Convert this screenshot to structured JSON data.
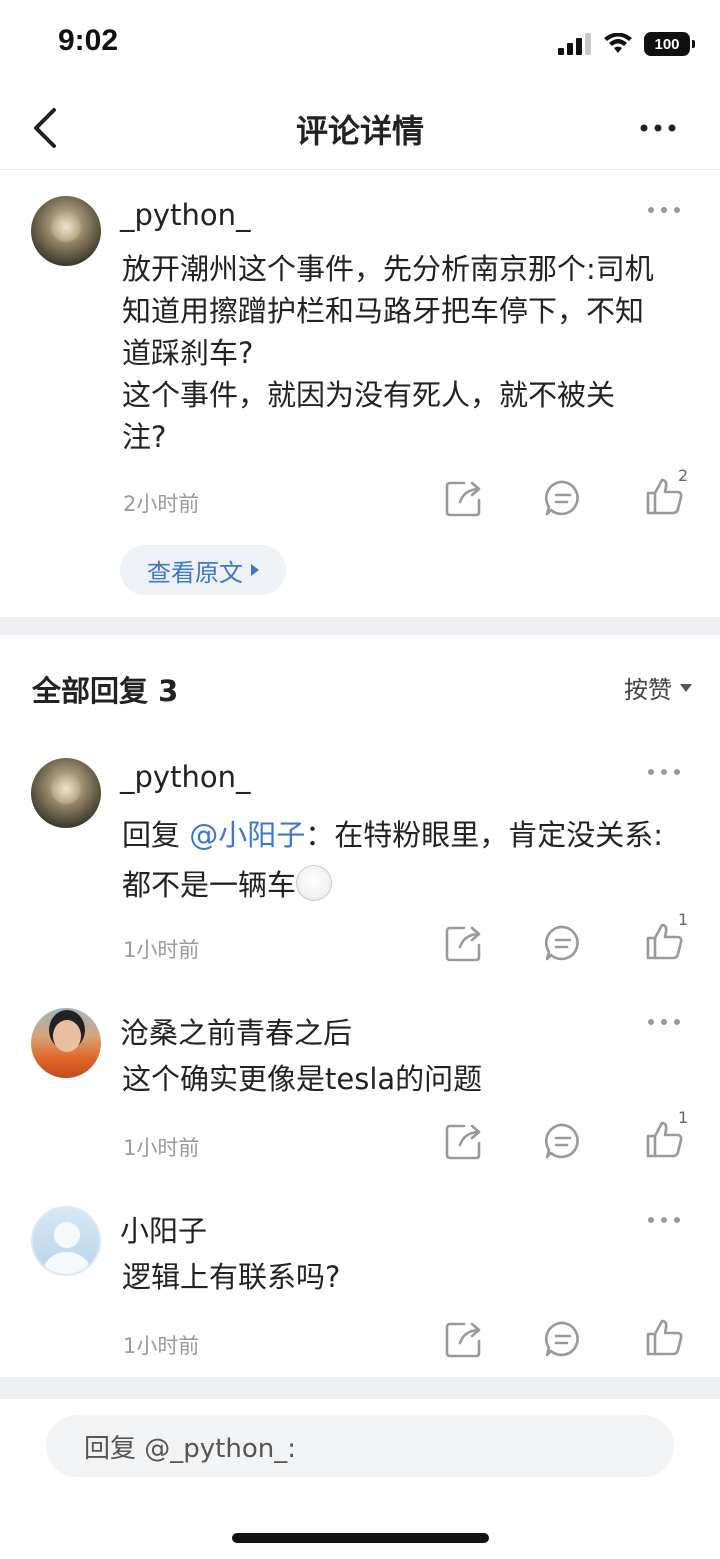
{
  "status_bar": {
    "time": "9:02",
    "battery": "100"
  },
  "nav": {
    "title": "评论详情"
  },
  "main_comment": {
    "username": "_python_",
    "lines": [
      "放开潮州这个事件，先分析南京那个:司机",
      "知道用擦蹭护栏和马路牙把车停下，不知",
      "道踩刹车?",
      "这个事件，就因为没有死人，就不被关",
      "注?"
    ],
    "time": "2小时前",
    "like_count": "2",
    "view_original": "查看原文"
  },
  "replies_header": {
    "label": "全部回复 3",
    "sort": "按赞"
  },
  "replies": [
    {
      "username": "_python_",
      "prefix": "回复 ",
      "mention": "@小阳子",
      "text_line1": "：在特粉眼里，肯定没关系:",
      "text_line2": "都不是一辆车",
      "time": "1小时前",
      "like_count": "1"
    },
    {
      "username": "沧桑之前青春之后",
      "text": "这个确实更像是tesla的问题",
      "time": "1小时前",
      "like_count": "1"
    },
    {
      "username": "小阳子",
      "text": "逻辑上有联系吗?",
      "time": "1小时前",
      "like_count": ""
    }
  ],
  "reply_bar": {
    "placeholder": "回复 @_python_:"
  },
  "icons": {
    "share": "share-icon",
    "comment": "comment-icon",
    "like": "thumbs-up-icon",
    "more": "more-dots-icon",
    "back": "chevron-left-icon"
  },
  "colors": {
    "link": "#3d77c7",
    "muted": "#9a9a9a",
    "divider": "#eef0f3"
  }
}
